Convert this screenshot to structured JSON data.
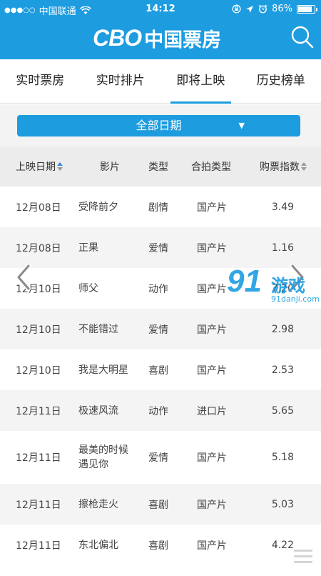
{
  "status_bar": {
    "signal": "●●●○○",
    "carrier": "中国联通",
    "time": "14:12",
    "battery_text": "86%",
    "battery_level": 0.86
  },
  "header": {
    "logo_latin": "CBO",
    "logo_cn": "中国票房",
    "search_icon": "search-icon"
  },
  "tabs": [
    {
      "label": "实时票房",
      "active": false
    },
    {
      "label": "实时排片",
      "active": false
    },
    {
      "label": "即将上映",
      "active": true
    },
    {
      "label": "历史榜单",
      "active": false
    }
  ],
  "filter": {
    "date_label": "全部日期",
    "caret": "▼"
  },
  "table": {
    "headers": {
      "date": "上映日期",
      "film": "影片",
      "type": "类型",
      "co": "合拍类型",
      "index": "购票指数"
    },
    "rows": [
      {
        "date": "12月08日",
        "film": "受降前夕",
        "type": "剧情",
        "co": "国产片",
        "index": "3.49"
      },
      {
        "date": "12月08日",
        "film": "正果",
        "type": "爱情",
        "co": "国产片",
        "index": "1.16"
      },
      {
        "date": "12月10日",
        "film": "师父",
        "type": "动作",
        "co": "国产片",
        "index": "7.20"
      },
      {
        "date": "12月10日",
        "film": "不能错过",
        "type": "爱情",
        "co": "国产片",
        "index": "2.98"
      },
      {
        "date": "12月10日",
        "film": "我是大明星",
        "type": "喜剧",
        "co": "国产片",
        "index": "2.53"
      },
      {
        "date": "12月11日",
        "film": "极速风流",
        "type": "动作",
        "co": "进口片",
        "index": "5.65"
      },
      {
        "date": "12月11日",
        "film": "最美的时候遇见你",
        "type": "爱情",
        "co": "国产片",
        "index": "5.18"
      },
      {
        "date": "12月11日",
        "film": "擦枪走火",
        "type": "喜剧",
        "co": "国产片",
        "index": "5.03"
      },
      {
        "date": "12月11日",
        "film": "东北偏北",
        "type": "喜剧",
        "co": "国产片",
        "index": "4.22"
      }
    ]
  },
  "watermark": {
    "num": "91",
    "cn": "游戏",
    "url": "91danji.com"
  },
  "colors": {
    "brand": "#1d9ce0",
    "row_alt": "#f4f4f4",
    "header_bg": "#ececec"
  }
}
